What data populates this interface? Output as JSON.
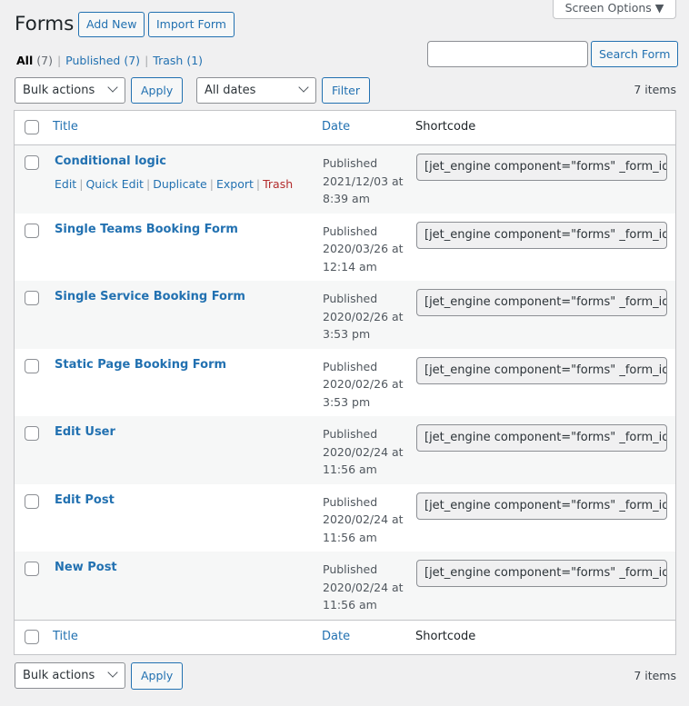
{
  "header": {
    "title": "Forms",
    "add_new_label": "Add New",
    "import_label": "Import Form",
    "screen_options_label": "Screen Options ▼"
  },
  "views": {
    "all_label": "All",
    "all_count": "(7)",
    "published_label": "Published",
    "published_count": "(7)",
    "trash_label": "Trash",
    "trash_count": "(1)"
  },
  "search": {
    "value": "",
    "placeholder": "",
    "button_label": "Search Form"
  },
  "toolbar_top": {
    "bulk_actions_selected": "Bulk actions",
    "apply_label": "Apply",
    "dates_selected": "All dates",
    "filter_label": "Filter",
    "items_count": "7 items"
  },
  "table": {
    "columns": {
      "title": "Title",
      "date": "Date",
      "shortcode": "Shortcode"
    },
    "row_actions": {
      "edit": "Edit",
      "quick_edit": "Quick Edit",
      "duplicate": "Duplicate",
      "export": "Export",
      "trash": "Trash"
    },
    "rows": [
      {
        "title": "Conditional logic",
        "status": "Published",
        "date": "2021/12/03 at",
        "time": "8:39 am",
        "shortcode": "[jet_engine component=\"forms\" _form_id="
      },
      {
        "title": "Single Teams Booking Form",
        "status": "Published",
        "date": "2020/03/26 at",
        "time": "12:14 am",
        "shortcode": "[jet_engine component=\"forms\" _form_id="
      },
      {
        "title": "Single Service Booking Form",
        "status": "Published",
        "date": "2020/02/26 at",
        "time": "3:53 pm",
        "shortcode": "[jet_engine component=\"forms\" _form_id="
      },
      {
        "title": "Static Page Booking Form",
        "status": "Published",
        "date": "2020/02/26 at",
        "time": "3:53 pm",
        "shortcode": "[jet_engine component=\"forms\" _form_id="
      },
      {
        "title": "Edit User",
        "status": "Published",
        "date": "2020/02/24 at",
        "time": "11:56 am",
        "shortcode": "[jet_engine component=\"forms\" _form_id="
      },
      {
        "title": "Edit Post",
        "status": "Published",
        "date": "2020/02/24 at",
        "time": "11:56 am",
        "shortcode": "[jet_engine component=\"forms\" _form_id="
      },
      {
        "title": "New Post",
        "status": "Published",
        "date": "2020/02/24 at",
        "time": "11:56 am",
        "shortcode": "[jet_engine component=\"forms\" _form_id="
      }
    ]
  },
  "toolbar_bottom": {
    "bulk_actions_selected": "Bulk actions",
    "apply_label": "Apply",
    "items_count": "7 items"
  }
}
